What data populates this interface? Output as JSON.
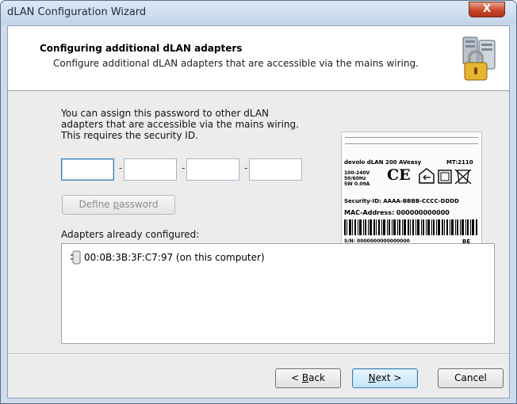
{
  "window": {
    "title": "dLAN Configuration Wizard",
    "close_label": "X"
  },
  "header": {
    "title": "Configuring additional dLAN adapters",
    "subtitle": "Configure additional dLAN adapters that are accessible via the mains wiring.",
    "icon": "locked-computers-icon"
  },
  "body": {
    "info_line1": "You can assign this password to other dLAN",
    "info_line2": "adapters that are accessible via the mains wiring.",
    "info_line3": "This requires the security ID.",
    "password_fields": [
      "",
      "",
      "",
      ""
    ],
    "separator": "-",
    "define_button_prefix": "Define ",
    "define_button_hotkey": "p",
    "define_button_suffix": "assword",
    "adapters_label": "Adapters already configured:",
    "adapters": [
      {
        "text": "00:0B:3B:3F:C7:97  (on this computer)",
        "icon": "dlan-adapter-icon"
      }
    ]
  },
  "device_label": {
    "model": "devolo dLAN 200 AVeasy",
    "mt": "MT:2110",
    "voltage_line1": "100-240V",
    "voltage_line2": "50/60Hz",
    "voltage_line3": "5W 0.09A",
    "ce_mark": "CE",
    "security_id": "Security-ID: AAAA-BBBB-CCCC-DDDD",
    "mac": "MAC-Address: 000000000000",
    "serial": "S/N: 0000000000000000",
    "country": "BE"
  },
  "footer": {
    "back_prefix": "< ",
    "back_hotkey": "B",
    "back_suffix": "ack",
    "next_hotkey": "N",
    "next_suffix": "ext >",
    "cancel_label": "Cancel"
  }
}
